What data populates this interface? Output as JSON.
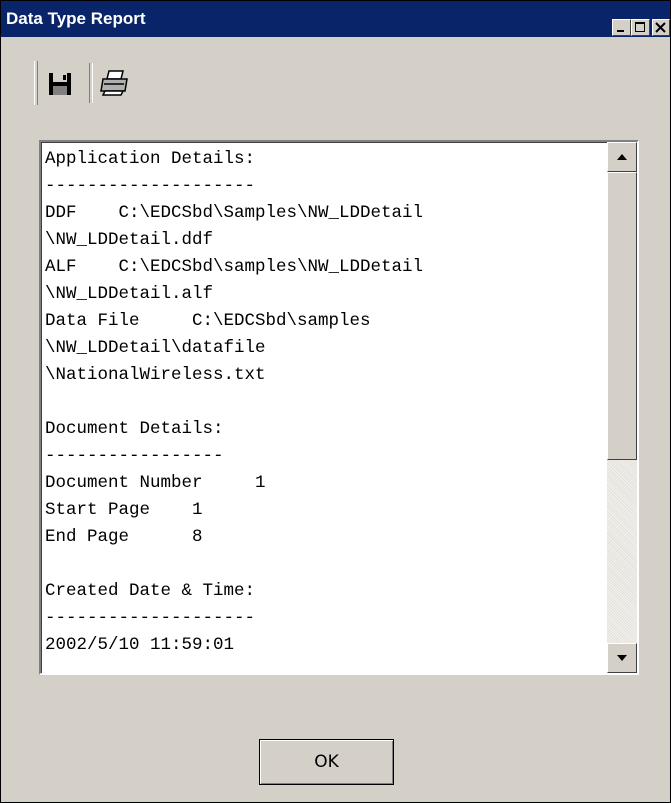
{
  "window": {
    "title": "Data Type Report"
  },
  "titlebar": {
    "buttons": [
      {
        "name": "minimize-button",
        "icon": "minimize-icon"
      },
      {
        "name": "maximize-button",
        "icon": "maximize-icon"
      },
      {
        "name": "close-button",
        "icon": "close-icon"
      }
    ]
  },
  "toolbar": {
    "tools": [
      {
        "name": "save-button",
        "icon": "save-icon"
      },
      {
        "name": "print-button",
        "icon": "print-icon"
      }
    ]
  },
  "report": {
    "lines": [
      "Application Details:",
      "--------------------",
      "DDF    C:\\EDCSbd\\Samples\\NW_LDDetail",
      "\\NW_LDDetail.ddf",
      "ALF    C:\\EDCSbd\\samples\\NW_LDDetail",
      "\\NW_LDDetail.alf",
      "Data File     C:\\EDCSbd\\samples",
      "\\NW_LDDetail\\datafile",
      "\\NationalWireless.txt",
      "",
      "Document Details:",
      "-----------------",
      "Document Number     1",
      "Start Page    1",
      "End Page      8",
      "",
      "Created Date & Time:",
      "--------------------",
      "2002/5/10 11:59:01"
    ]
  },
  "ok_label": "OK",
  "colors": {
    "titlebar": "#0a246a",
    "face": "#d4d0c8"
  }
}
